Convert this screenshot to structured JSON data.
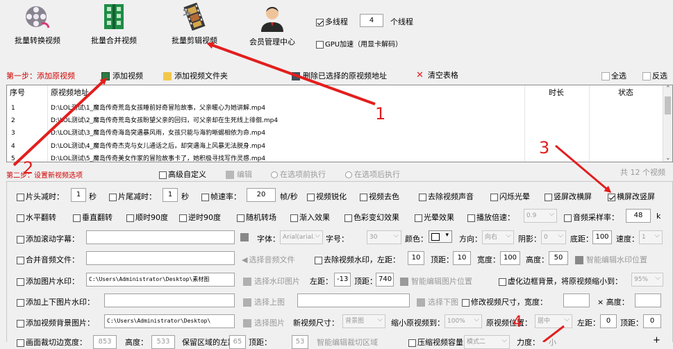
{
  "toolbar": {
    "items": [
      {
        "label": "批量转换视频",
        "icon": "film-reel-icon"
      },
      {
        "label": "批量合并视频",
        "icon": "merge-grid-icon"
      },
      {
        "label": "批量剪辑视频",
        "icon": "film-strip-icon"
      },
      {
        "label": "会员管理中心",
        "icon": "member-avatar-icon"
      }
    ],
    "multithread_label": "多线程",
    "thread_count": "4",
    "threads_suffix": "个线程",
    "gpu_label": "GPU加速（用显卡解码）"
  },
  "step1": {
    "label": "第一步：添加原视频",
    "add_video": "添加视频",
    "add_folder": "添加视频文件夹",
    "delete_selected": "删除已选择的原视频地址",
    "clear_table": "清空表格",
    "select_all": "全选",
    "invert": "反选"
  },
  "table": {
    "headers": {
      "no": "序号",
      "path": "原视频地址",
      "duration": "时长",
      "status": "状态"
    },
    "rows": [
      {
        "no": "1",
        "path": "D:\\LOL测试\\1_魔岛传奇荒岛女孩睡前好奇冒险故事，父亲暖心为她讲解.mp4"
      },
      {
        "no": "2",
        "path": "D:\\LOL测试\\2_魔岛传奇荒岛女孩盼望父亲的回归，可父亲却在生死线上徘徊.mp4"
      },
      {
        "no": "3",
        "path": "D:\\LOL测试\\3_魔岛传奇海岛突遇暴风雨，女孩只能与海豹晰蜴相依为命.mp4"
      },
      {
        "no": "4",
        "path": "D:\\LOL测试\\4_魔岛传奇杰克与女儿通话之后，却突遇海上风暴无法脱身.mp4"
      },
      {
        "no": "5",
        "path": "D:\\LOL测试\\5_魔岛传奇美女作家的冒险故事卡了，她积极寻找写作灵感.mp4"
      }
    ]
  },
  "step2": {
    "label": "第二步：设置新视频选项",
    "advanced": "高级自定义",
    "edit": "编辑",
    "before_exec": "在选项前执行",
    "after_exec": "在选项后执行",
    "total": "共 12 个视频"
  },
  "row1": {
    "head_cut": "片头减时：",
    "head_val": "1",
    "sec1": "秒",
    "tail_cut": "片尾减时：",
    "tail_val": "1",
    "sec2": "秒",
    "fps": "帧速率：",
    "fps_val": "20",
    "fps_unit": "帧/秒",
    "sharpen": "视频锐化",
    "decolor": "视频去色",
    "mute": "去除视频声音",
    "flash": "闪烁光晕",
    "v2h": "竖屏改横屏",
    "h2v": "横屏改竖屏"
  },
  "row2": {
    "hflip": "水平翻转",
    "vflip": "垂直翻转",
    "cw90": "顺时90度",
    "ccw90": "逆时90度",
    "transition": "随机转场",
    "fadein": "渐入效果",
    "color_fx": "色彩变幻效果",
    "halo": "光晕效果",
    "speed": "播放倍速：",
    "speed_val": "0.9",
    "sample_rate": "音频采样率：",
    "sample_val": "48",
    "sample_unit": "k"
  },
  "row3": {
    "subtitle": "添加滚动字幕：",
    "font": "字体：",
    "font_val": "Arial(arial.",
    "size": "字号：",
    "size_val": "30",
    "color": "颜色：",
    "direction": "方向：",
    "direction_val": "向右",
    "shadow": "阴影：",
    "shadow_val": "0",
    "bottom": "底距：",
    "bottom_val": "100",
    "speed": "速度：",
    "speed_val": "1"
  },
  "row4": {
    "audio": "合并音频文件：",
    "choose_audio": "选择音频文件",
    "remove_wm": "去除视频水印，左距：",
    "left_val": "10",
    "top": "顶距：",
    "top_val": "10",
    "width": "宽度：",
    "width_val": "100",
    "height": "高度：",
    "height_val": "50",
    "smart_wm": "智能编辑水印位置"
  },
  "row5": {
    "img_wm": "添加图片水印：",
    "path": "C:\\Users\\Administrator\\Desktop\\素材图",
    "choose_img": "选择水印图片",
    "left": "左距：",
    "left_val": "-13",
    "top": "顶距：",
    "top_val": "740",
    "smart_img": "智能编辑图片位置",
    "blur_bg": "虚化边框背景，将原视频缩小到：",
    "shrink_val": "95%"
  },
  "row6": {
    "updown": "添加上下图片水印：",
    "choose_up": "选择上图",
    "choose_down": "选择下图",
    "resize": "修改视频尺寸，宽度：",
    "times": "× 高度："
  },
  "row7": {
    "bg_img": "添加视频背景图片：",
    "path": "C:\\Users\\Administrator\\Desktop\\",
    "choose": "选择图片",
    "new_size": "新视频尺寸：",
    "new_size_val": "背景图",
    "shrink": "缩小原视频到：",
    "shrink_val": "100%",
    "position": "原视频位置：",
    "position_val": "居中",
    "left": "左距：",
    "left_val": "0",
    "top": "顶距：",
    "top_val": "0"
  },
  "row8": {
    "crop": "画面裁切边宽度：",
    "crop_val": "853",
    "height": "高度：",
    "height_val": "533",
    "keep": "保留区域的左距：",
    "keep_val": "65",
    "top": "顶距：",
    "top_val": "53",
    "smart_crop": "智能编辑裁切区域",
    "compress": "压缩视频容量",
    "mode_val": "模式二",
    "strength": "力度：",
    "low": "小"
  },
  "annotations": {
    "n1": "1",
    "n2": "2",
    "n3": "3",
    "n4": "4"
  },
  "colors": {
    "arrow": "#e31e1e",
    "step_label": "#d00000"
  }
}
